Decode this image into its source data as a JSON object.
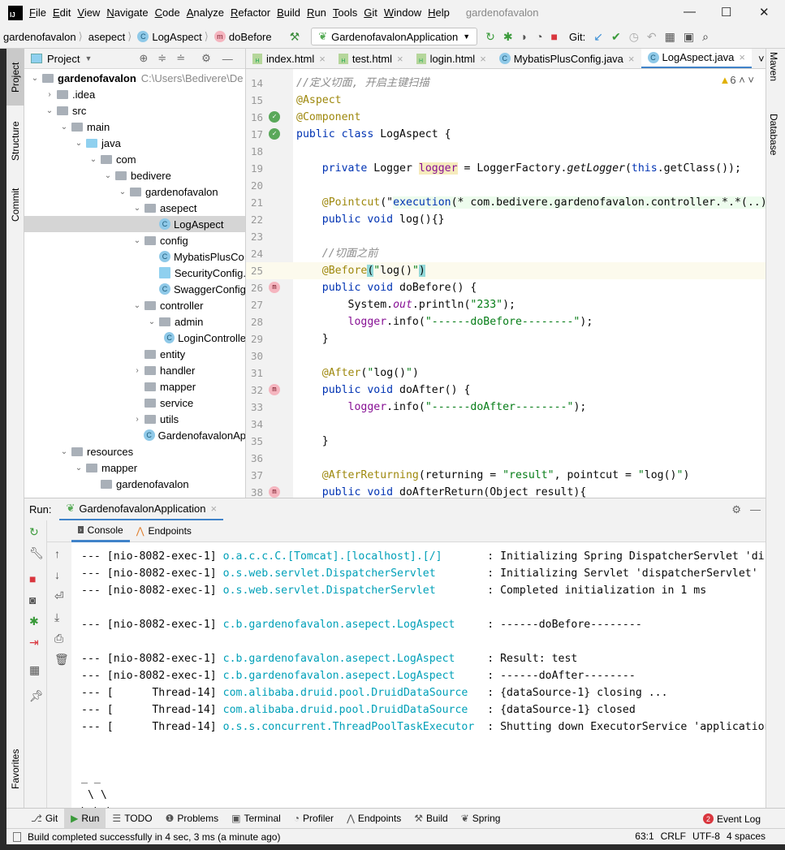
{
  "titlebar": {
    "menu": [
      "File",
      "Edit",
      "View",
      "Navigate",
      "Code",
      "Analyze",
      "Refactor",
      "Build",
      "Run",
      "Tools",
      "Git",
      "Window",
      "Help"
    ],
    "title": "gardenofavalon"
  },
  "navbar": {
    "crumbs": [
      "gardenofavalon",
      "asepect",
      "LogAspect",
      "doBefore"
    ],
    "run_config": "GardenofavalonApplication",
    "git_label": "Git:"
  },
  "left_strip": [
    "Project",
    "Structure",
    "Commit",
    "Favorites"
  ],
  "right_strip": [
    "Maven",
    "Database"
  ],
  "project": {
    "title": "Project",
    "tree": [
      {
        "label": "gardenofavalon",
        "path": "C:\\Users\\Bedivere\\De",
        "depth": 0,
        "arrow": "open",
        "icon": "module",
        "bold": true
      },
      {
        "label": ".idea",
        "depth": 1,
        "arrow": "closed",
        "icon": "folder"
      },
      {
        "label": "src",
        "depth": 1,
        "arrow": "open",
        "icon": "folder"
      },
      {
        "label": "main",
        "depth": 2,
        "arrow": "open",
        "icon": "folder"
      },
      {
        "label": "java",
        "depth": 3,
        "arrow": "open",
        "icon": "source-folder"
      },
      {
        "label": "com",
        "depth": 4,
        "arrow": "open",
        "icon": "package"
      },
      {
        "label": "bedivere",
        "depth": 5,
        "arrow": "open",
        "icon": "package"
      },
      {
        "label": "gardenofavalon",
        "depth": 6,
        "arrow": "open",
        "icon": "package"
      },
      {
        "label": "asepect",
        "depth": 7,
        "arrow": "open",
        "icon": "package"
      },
      {
        "label": "LogAspect",
        "depth": 8,
        "arrow": "",
        "icon": "class",
        "selected": true
      },
      {
        "label": "config",
        "depth": 7,
        "arrow": "open",
        "icon": "package"
      },
      {
        "label": "MybatisPlusCo",
        "depth": 8,
        "arrow": "",
        "icon": "class"
      },
      {
        "label": "SecurityConfig.",
        "depth": 8,
        "arrow": "",
        "icon": "java-file"
      },
      {
        "label": "SwaggerConfig",
        "depth": 8,
        "arrow": "",
        "icon": "class"
      },
      {
        "label": "controller",
        "depth": 7,
        "arrow": "open",
        "icon": "package"
      },
      {
        "label": "admin",
        "depth": 8,
        "arrow": "open",
        "icon": "package"
      },
      {
        "label": "LoginControlle",
        "depth": 9,
        "arrow": "",
        "icon": "class"
      },
      {
        "label": "entity",
        "depth": 7,
        "arrow": "",
        "icon": "package"
      },
      {
        "label": "handler",
        "depth": 7,
        "arrow": "closed",
        "icon": "package"
      },
      {
        "label": "mapper",
        "depth": 7,
        "arrow": "",
        "icon": "package"
      },
      {
        "label": "service",
        "depth": 7,
        "arrow": "",
        "icon": "package"
      },
      {
        "label": "utils",
        "depth": 7,
        "arrow": "closed",
        "icon": "package"
      },
      {
        "label": "GardenofavalonAp",
        "depth": 7,
        "arrow": "",
        "icon": "spring-class"
      },
      {
        "label": "resources",
        "depth": 2,
        "arrow": "open",
        "icon": "resources-folder"
      },
      {
        "label": "mapper",
        "depth": 3,
        "arrow": "open",
        "icon": "folder"
      },
      {
        "label": "gardenofavalon",
        "depth": 4,
        "arrow": "",
        "icon": "folder"
      }
    ]
  },
  "tabs": [
    {
      "label": "index.html",
      "icon": "html"
    },
    {
      "label": "test.html",
      "icon": "html"
    },
    {
      "label": "login.html",
      "icon": "html"
    },
    {
      "label": "MybatisPlusConfig.java",
      "icon": "class"
    },
    {
      "label": "LogAspect.java",
      "icon": "class",
      "active": true
    }
  ],
  "editor": {
    "warnings": "6",
    "lines": [
      {
        "n": "14",
        "t": [
          [
            "cm",
            "//定义切面, 开启主键扫描"
          ]
        ]
      },
      {
        "n": "15",
        "t": [
          [
            "ann",
            "@Aspect"
          ]
        ]
      },
      {
        "n": "16",
        "g": "spring-bean",
        "t": [
          [
            "ann",
            "@Component"
          ]
        ]
      },
      {
        "n": "17",
        "g": "spring-class",
        "t": [
          [
            "kw",
            "public class "
          ],
          [
            "pl",
            "LogAspect {"
          ]
        ]
      },
      {
        "n": "18",
        "t": []
      },
      {
        "n": "19",
        "t": [
          [
            "pl",
            "    "
          ],
          [
            "kw",
            "private "
          ],
          [
            "pl",
            "Logger "
          ],
          [
            "fld hl",
            "logger"
          ],
          [
            "pl",
            " = LoggerFactory."
          ],
          [
            "it",
            "getLogger"
          ],
          [
            "pl",
            "("
          ],
          [
            "kw",
            "this"
          ],
          [
            "pl",
            ".getClass());"
          ]
        ]
      },
      {
        "n": "20",
        "t": []
      },
      {
        "n": "21",
        "t": [
          [
            "pl",
            "    "
          ],
          [
            "ann",
            "@Pointcut"
          ],
          [
            "pl",
            "(\""
          ],
          [
            "kw inj",
            "execution"
          ],
          [
            "pl inj",
            "(* com.bedivere.gardenofavalon.controller.*.*(..))"
          ],
          [
            "pl",
            "\")"
          ]
        ]
      },
      {
        "n": "22",
        "t": [
          [
            "pl",
            "    "
          ],
          [
            "kw",
            "public void "
          ],
          [
            "pl",
            "log(){}"
          ]
        ]
      },
      {
        "n": "23",
        "t": []
      },
      {
        "n": "24",
        "t": [
          [
            "pl",
            "    "
          ],
          [
            "cm",
            "//切面之前"
          ]
        ]
      },
      {
        "n": "25",
        "cur": true,
        "t": [
          [
            "pl",
            "    "
          ],
          [
            "ann",
            "@Before"
          ],
          [
            "pl br",
            "("
          ],
          [
            "str",
            "\""
          ],
          [
            "pl",
            "log()"
          ],
          [
            "str",
            "\""
          ],
          [
            "pl br",
            ")"
          ]
        ]
      },
      {
        "n": "26",
        "g": "method",
        "t": [
          [
            "pl",
            "    "
          ],
          [
            "kw",
            "public void "
          ],
          [
            "pl",
            "doBefore() {"
          ]
        ]
      },
      {
        "n": "27",
        "t": [
          [
            "pl",
            "        System."
          ],
          [
            "fldi",
            "out"
          ],
          [
            "pl",
            ".println("
          ],
          [
            "str",
            "\"233\""
          ],
          [
            "pl",
            ");"
          ]
        ]
      },
      {
        "n": "28",
        "t": [
          [
            "pl",
            "        "
          ],
          [
            "fld",
            "logger"
          ],
          [
            "pl",
            ".info("
          ],
          [
            "str",
            "\"------doBefore--------\""
          ],
          [
            "pl",
            ");"
          ]
        ]
      },
      {
        "n": "29",
        "t": [
          [
            "pl",
            "    }"
          ]
        ]
      },
      {
        "n": "30",
        "t": []
      },
      {
        "n": "31",
        "t": [
          [
            "pl",
            "    "
          ],
          [
            "ann",
            "@After"
          ],
          [
            "pl",
            "("
          ],
          [
            "str",
            "\""
          ],
          [
            "pl",
            "log()"
          ],
          [
            "str",
            "\""
          ],
          [
            "pl",
            ")"
          ]
        ]
      },
      {
        "n": "32",
        "g": "method",
        "t": [
          [
            "pl",
            "    "
          ],
          [
            "kw",
            "public void "
          ],
          [
            "pl",
            "doAfter() {"
          ]
        ]
      },
      {
        "n": "33",
        "t": [
          [
            "pl",
            "        "
          ],
          [
            "fld",
            "logger"
          ],
          [
            "pl",
            ".info("
          ],
          [
            "str",
            "\"------doAfter--------\""
          ],
          [
            "pl",
            ");"
          ]
        ]
      },
      {
        "n": "34",
        "t": []
      },
      {
        "n": "35",
        "t": [
          [
            "pl",
            "    }"
          ]
        ]
      },
      {
        "n": "36",
        "t": []
      },
      {
        "n": "37",
        "t": [
          [
            "pl",
            "    "
          ],
          [
            "ann",
            "@AfterReturning"
          ],
          [
            "pl",
            "(returning = "
          ],
          [
            "str",
            "\"result\""
          ],
          [
            "pl",
            ", pointcut = "
          ],
          [
            "str",
            "\""
          ],
          [
            "pl",
            "log()"
          ],
          [
            "str",
            "\""
          ],
          [
            "pl",
            ")"
          ]
        ]
      },
      {
        "n": "38",
        "g": "method",
        "t": [
          [
            "pl",
            "    "
          ],
          [
            "kw",
            "public void "
          ],
          [
            "pl",
            "doAfterReturn(Object result){"
          ]
        ]
      }
    ]
  },
  "run": {
    "label": "Run:",
    "tab": "GardenofavalonApplication",
    "console_tabs": [
      "Console",
      "Endpoints"
    ],
    "lines": [
      {
        "p": "--- [nio-8082-exec-1] ",
        "l": "o.a.c.c.C.[Tomcat].[localhost].[/]      ",
        "m": " : Initializing Spring DispatcherServlet 'dispatcherServlet'"
      },
      {
        "p": "--- [nio-8082-exec-1] ",
        "l": "o.s.web.servlet.DispatcherServlet       ",
        "m": " : Initializing Servlet 'dispatcherServlet'"
      },
      {
        "p": "--- [nio-8082-exec-1] ",
        "l": "o.s.web.servlet.DispatcherServlet       ",
        "m": " : Completed initialization in 1 ms"
      },
      {
        "p": "",
        "l": "",
        "m": ""
      },
      {
        "p": "--- [nio-8082-exec-1] ",
        "l": "c.b.gardenofavalon.asepect.LogAspect    ",
        "m": " : ------doBefore--------"
      },
      {
        "p": "",
        "l": "",
        "m": ""
      },
      {
        "p": "--- [nio-8082-exec-1] ",
        "l": "c.b.gardenofavalon.asepect.LogAspect    ",
        "m": " : Result: test"
      },
      {
        "p": "--- [nio-8082-exec-1] ",
        "l": "c.b.gardenofavalon.asepect.LogAspect    ",
        "m": " : ------doAfter--------"
      },
      {
        "p": "--- [      Thread-14] ",
        "l": "com.alibaba.druid.pool.DruidDataSource  ",
        "m": " : {dataSource-1} closing ..."
      },
      {
        "p": "--- [      Thread-14] ",
        "l": "com.alibaba.druid.pool.DruidDataSource  ",
        "m": " : {dataSource-1} closed"
      },
      {
        "p": "--- [      Thread-14] ",
        "l": "o.s.s.concurrent.ThreadPoolTaskExecutor ",
        "m": " : Shutting down ExecutorService 'applicationTaskExecutor'"
      },
      {
        "p": "",
        "l": "",
        "m": ""
      },
      {
        "p": "",
        "l": "",
        "m": ""
      },
      {
        "p": "_ _",
        "l": "",
        "m": ""
      },
      {
        "p": " \\ \\",
        "l": "",
        "m": ""
      },
      {
        "p": "\\ \\ \\",
        "l": "",
        "m": ""
      }
    ]
  },
  "bottombar": {
    "tabs": [
      "Git",
      "Run",
      "TODO",
      "Problems",
      "Terminal",
      "Profiler",
      "Endpoints",
      "Build",
      "Spring"
    ],
    "active": "Run",
    "event_log": "Event Log",
    "event_count": "2"
  },
  "status": {
    "message": "Build completed successfully in 4 sec, 3 ms (a minute ago)",
    "position": "63:1",
    "line_sep": "CRLF",
    "encoding": "UTF-8",
    "indent": "4 spaces"
  },
  "colors": {
    "accent": "#4083c9",
    "keyword": "#0033b3",
    "annotation": "#9e880d",
    "string": "#067d17",
    "field": "#871094",
    "logger_name": "#00a0b8"
  }
}
